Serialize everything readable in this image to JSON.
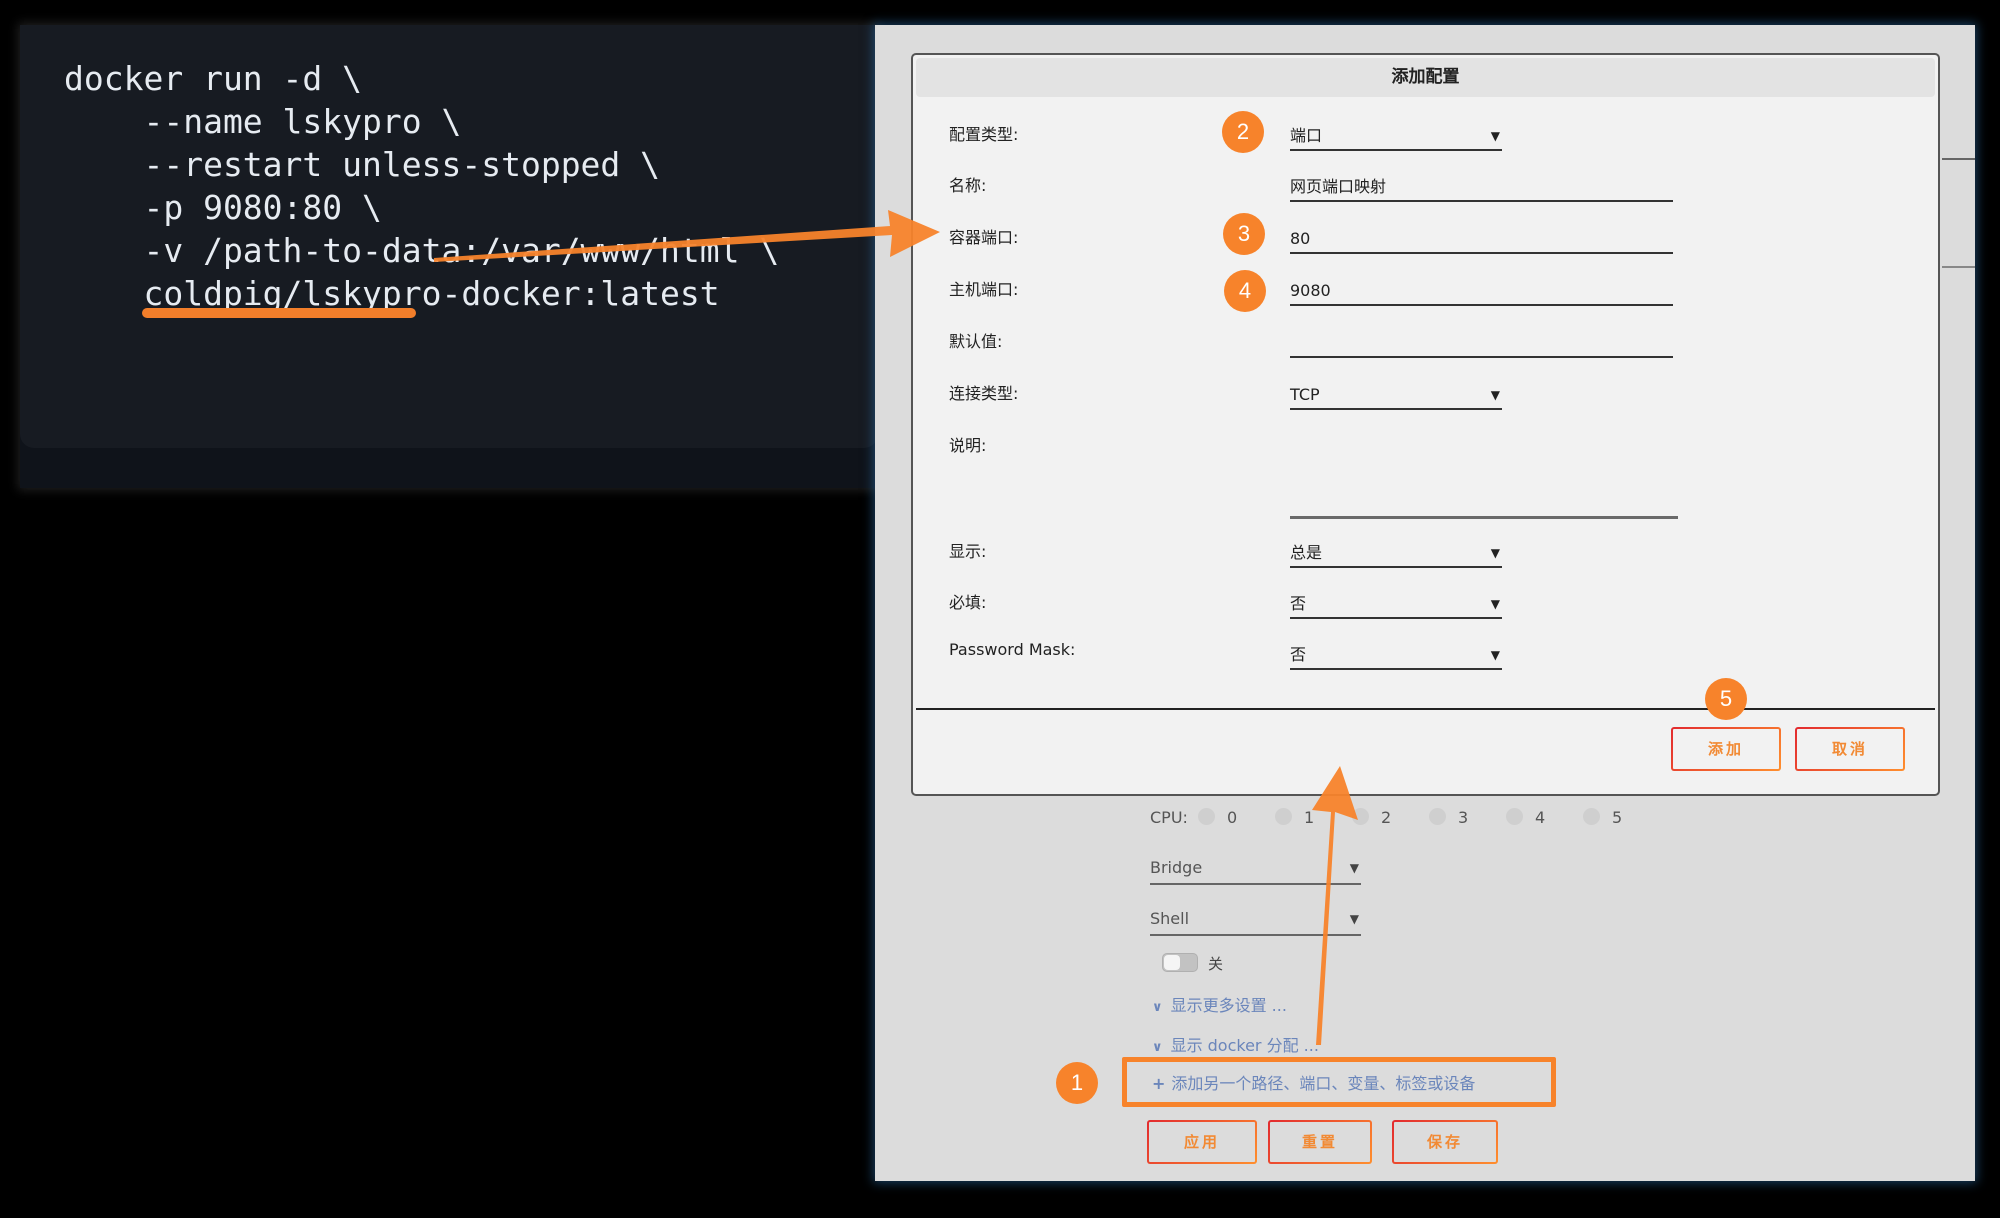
{
  "code": {
    "lines": [
      "docker run -d \\",
      "    --name lskypro \\",
      "    --restart unless-stopped \\",
      "    -p 9080:80 \\",
      "    -v /path-to-data:/var/www/html \\",
      "    coldpig/lskypro-docker:latest"
    ]
  },
  "dialog": {
    "title": "添加配置",
    "fields": {
      "config_type": {
        "label": "配置类型:",
        "value": "端口"
      },
      "name": {
        "label": "名称:",
        "value": "网页端口映射"
      },
      "container_port": {
        "label": "容器端口:",
        "value": "80"
      },
      "host_port": {
        "label": "主机端口:",
        "value": "9080"
      },
      "default_value": {
        "label": "默认值:",
        "value": ""
      },
      "connection_type": {
        "label": "连接类型:",
        "value": "TCP"
      },
      "description": {
        "label": "说明:",
        "value": ""
      },
      "display": {
        "label": "显示:",
        "value": "总是"
      },
      "required": {
        "label": "必填:",
        "value": "否"
      },
      "password_mask": {
        "label": "Password Mask:",
        "value": "否"
      }
    },
    "add_label": "添加",
    "cancel_label": "取消"
  },
  "main": {
    "cpu_label": "CPU:",
    "cpu_options": [
      "0",
      "1",
      "2",
      "3",
      "4",
      "5"
    ],
    "network_select": "Bridge",
    "shell_select": "Shell",
    "toggle_label": "关",
    "toggle_on": false,
    "show_more_label": "显示更多设置 ...",
    "show_docker_label": "显示 docker 分配 ...",
    "add_another_label": "添加另一个路径、端口、变量、标签或设备",
    "apply_label": "应用",
    "reset_label": "重置",
    "save_label": "保存"
  },
  "badges": [
    "1",
    "2",
    "3",
    "4",
    "5"
  ],
  "colors": {
    "accent_orange": "#f7832b",
    "link_blue": "#6b86bb",
    "button_gradient_start": "#e22a2f",
    "button_gradient_end": "#ff8f2e"
  }
}
